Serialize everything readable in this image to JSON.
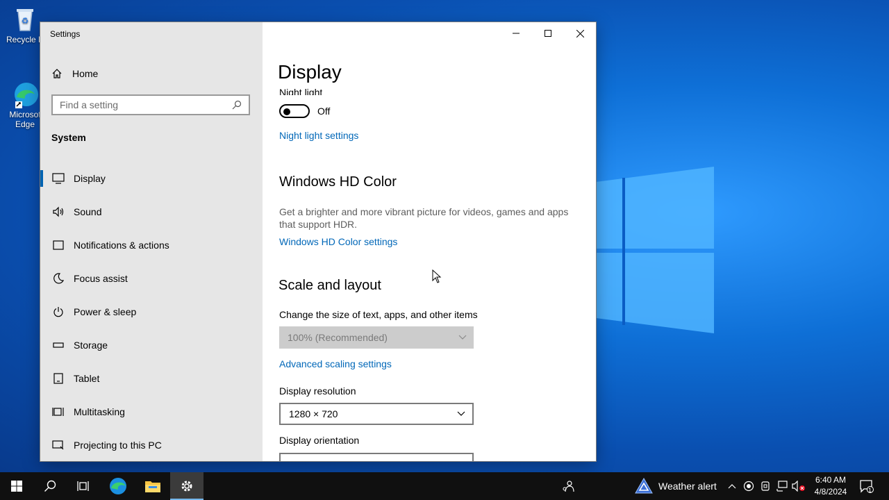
{
  "desktop": {
    "icons": [
      {
        "label": "Recycle Bin",
        "visible_label": "Recycle B"
      },
      {
        "label_line1": "Microsof",
        "label_line2": "Edge"
      }
    ]
  },
  "window": {
    "title": "Settings",
    "buttons": [
      "minimize",
      "maximize",
      "close"
    ]
  },
  "sidebar": {
    "home_label": "Home",
    "search_placeholder": "Find a setting",
    "section": "System",
    "items": [
      {
        "label": "Display",
        "icon": "monitor-icon",
        "active": true
      },
      {
        "label": "Sound",
        "icon": "speaker-icon"
      },
      {
        "label": "Notifications & actions",
        "icon": "notification-icon"
      },
      {
        "label": "Focus assist",
        "icon": "moon-icon"
      },
      {
        "label": "Power & sleep",
        "icon": "power-icon"
      },
      {
        "label": "Storage",
        "icon": "storage-icon"
      },
      {
        "label": "Tablet",
        "icon": "tablet-icon"
      },
      {
        "label": "Multitasking",
        "icon": "multitasking-icon"
      },
      {
        "label": "Projecting to this PC",
        "icon": "projector-icon"
      }
    ]
  },
  "content": {
    "title": "Display",
    "night_light": {
      "label": "Night light",
      "state": "Off",
      "link": "Night light settings"
    },
    "hd_color": {
      "heading": "Windows HD Color",
      "description": "Get a brighter and more vibrant picture for videos, games and apps that support HDR.",
      "link": "Windows HD Color settings"
    },
    "scale": {
      "heading": "Scale and layout",
      "size_label": "Change the size of text, apps, and other items",
      "size_value": "100% (Recommended)",
      "advanced_link": "Advanced scaling settings",
      "resolution_label": "Display resolution",
      "resolution_value": "1280 × 720",
      "orientation_label": "Display orientation"
    }
  },
  "taskbar": {
    "weather_label": "Weather alert",
    "time": "6:40 AM",
    "date": "4/8/2024",
    "notification_count": "1"
  },
  "colors": {
    "accent": "#0067b8",
    "sidebar_bg": "#e6e6e6",
    "taskbar_bg": "#101010"
  }
}
